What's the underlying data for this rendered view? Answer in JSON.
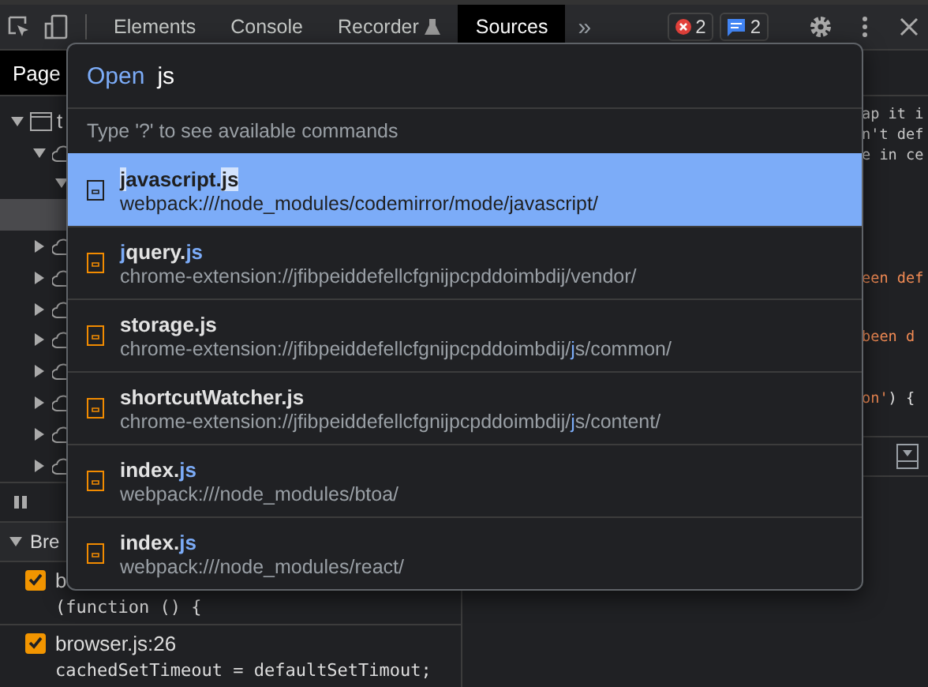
{
  "toolbar": {
    "tabs": [
      {
        "label": "Elements",
        "selected": false
      },
      {
        "label": "Console",
        "selected": false
      },
      {
        "label": "Recorder",
        "selected": false,
        "kind": "experimental"
      },
      {
        "label": "Sources",
        "selected": true
      }
    ],
    "more": "»",
    "errors": "2",
    "messages": "2"
  },
  "navigator": {
    "tabs": [
      {
        "label": "Page",
        "selected": true
      }
    ],
    "tree": [
      {
        "kind": "frame",
        "label": "t",
        "expanded": true,
        "selected": false,
        "children": [
          {
            "kind": "cloud",
            "expanded": true,
            "selected": false,
            "children": [
              {
                "expanded": true,
                "selected": false,
                "children": [
                  {
                    "selected": true
                  }
                ]
              }
            ]
          },
          {
            "kind": "cloud",
            "expanded": false,
            "selected": false
          },
          {
            "kind": "cloud",
            "expanded": false,
            "selected": false
          },
          {
            "kind": "cloud",
            "expanded": false,
            "selected": false
          },
          {
            "kind": "cloud",
            "expanded": false,
            "selected": false
          },
          {
            "kind": "cloud",
            "expanded": false,
            "selected": false
          },
          {
            "kind": "cloud",
            "expanded": false,
            "selected": false
          },
          {
            "kind": "cloud",
            "expanded": false,
            "selected": false
          },
          {
            "kind": "cloud",
            "expanded": false,
            "selected": false
          }
        ]
      }
    ]
  },
  "editor": {
    "lines": [
      [
        {
          "text": "ap it i",
          "kind": "comment"
        }
      ],
      [
        {
          "text": "n't def",
          "kind": "comment"
        }
      ],
      [
        {
          "text": "e in ce",
          "kind": "comment"
        }
      ],
      [
        {
          "text": "een def",
          "kind": "string"
        }
      ],
      [
        {
          "text": "been d",
          "kind": "string"
        }
      ],
      [
        {
          "text": "on'",
          "kind": "string"
        },
        {
          "text": ") {",
          "kind": "plain"
        }
      ]
    ]
  },
  "breakpoints": {
    "title": "Bre",
    "expanded": true,
    "items": [
      {
        "label": "b",
        "code": "(function () {",
        "checked": true
      },
      {
        "label": "browser.js:26",
        "code": "cachedSetTimeout = defaultSetTimout;",
        "checked": true
      }
    ]
  },
  "palette": {
    "prefix": "Open",
    "query": "js",
    "hint": "Type '?' to see available commands",
    "items": [
      {
        "selected": true,
        "name": [
          {
            "text": "j",
            "match": true
          },
          {
            "text": "avascript.",
            "match": false
          },
          {
            "text": "js",
            "match": true
          }
        ],
        "path": [
          {
            "text": "webpack:///node_modules/codemirror/mode/javascript/",
            "match": false
          }
        ]
      },
      {
        "selected": false,
        "name": [
          {
            "text": "j",
            "match": true
          },
          {
            "text": "query.",
            "match": false
          },
          {
            "text": "js",
            "match": true
          }
        ],
        "path": [
          {
            "text": "chrome-extension://jfibpeiddefellcfgnijpcpddoimbdij/vendor/",
            "match": false
          }
        ]
      },
      {
        "selected": false,
        "name": [
          {
            "text": "storage.js",
            "match": false
          }
        ],
        "path": [
          {
            "text": "chrome-extension://jfibpeiddefellcfgnijpcpddoimbdij/",
            "match": false
          },
          {
            "text": "j",
            "match": true
          },
          {
            "text": "s/common/",
            "match": false
          }
        ]
      },
      {
        "selected": false,
        "name": [
          {
            "text": "shortcutWatcher.js",
            "match": false
          }
        ],
        "path": [
          {
            "text": "chrome-extension://jfibpeiddefellcfgnijpcpddoimbdij/",
            "match": false
          },
          {
            "text": "j",
            "match": true
          },
          {
            "text": "s/content/",
            "match": false
          }
        ]
      },
      {
        "selected": false,
        "name": [
          {
            "text": "index.",
            "match": false
          },
          {
            "text": "js",
            "match": true
          }
        ],
        "path": [
          {
            "text": "webpack:///node_modules/btoa/",
            "match": false
          }
        ]
      },
      {
        "selected": false,
        "name": [
          {
            "text": "index.",
            "match": false
          },
          {
            "text": "js",
            "match": true
          }
        ],
        "path": [
          {
            "text": "webpack:///node_modules/react/",
            "match": false
          }
        ]
      }
    ]
  }
}
